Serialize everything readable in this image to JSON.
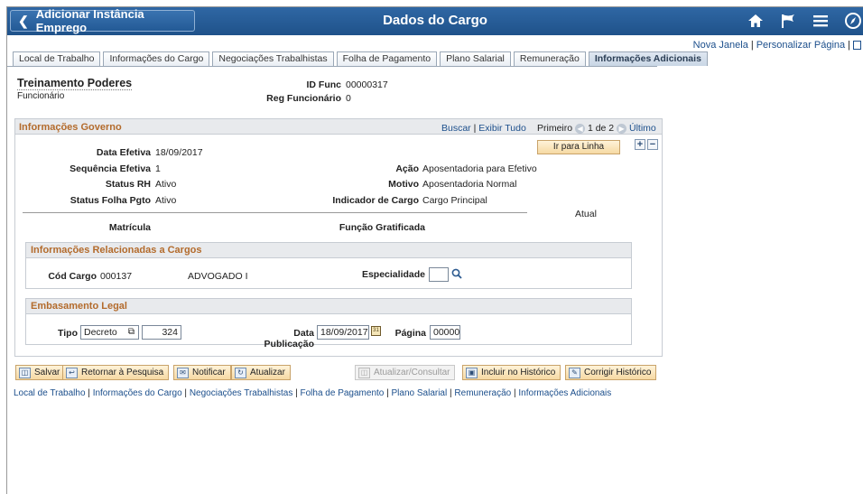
{
  "header": {
    "back_label": "Adicionar Instância Emprego",
    "title": "Dados do Cargo",
    "icons": [
      "home-icon",
      "flag-icon",
      "menu-icon",
      "compass-icon"
    ]
  },
  "top_links": {
    "new_window": "Nova Janela",
    "personalize": "Personalizar Página"
  },
  "tabs": [
    {
      "label": "Local de Trabalho"
    },
    {
      "label": "Informações do Cargo"
    },
    {
      "label": "Negociações Trabalhistas"
    },
    {
      "label": "Folha de Pagamento"
    },
    {
      "label": "Plano Salarial"
    },
    {
      "label": "Remuneração"
    },
    {
      "label": "Informações Adicionais"
    }
  ],
  "employee": {
    "name": "Treinamento Poderes",
    "role": "Funcionário",
    "id_label": "ID Func",
    "id_value": "00000317",
    "reg_label": "Reg Funcionário",
    "reg_value": "0"
  },
  "gov": {
    "title": "Informações Governo",
    "search": "Buscar",
    "view_all": "Exibir Tudo",
    "first": "Primeiro",
    "pagination": "1 de 2",
    "last": "Último",
    "goto_row": "Ir para Linha",
    "data_efetiva_label": "Data Efetiva",
    "data_efetiva": "18/09/2017",
    "seq_label": "Sequência Efetiva",
    "seq": "1",
    "status_rh_label": "Status RH",
    "status_rh": "Ativo",
    "status_folha_label": "Status Folha Pgto",
    "status_folha": "Ativo",
    "acao_label": "Ação",
    "acao": "Aposentadoria para Efetivo",
    "motivo_label": "Motivo",
    "motivo": "Aposentadoria Normal",
    "indicador_label": "Indicador de Cargo",
    "indicador": "Cargo Principal",
    "atual": "Atual",
    "matricula_label": "Matrícula",
    "funcao_label": "Função Gratificada"
  },
  "cargos": {
    "title": "Informações Relacionadas a Cargos",
    "cod_label": "Cód Cargo",
    "cod_value": "000137",
    "cargo_desc": "ADVOGADO I",
    "especialidade_label": "Especialidade",
    "especialidade_value": ""
  },
  "legal": {
    "title": "Embasamento Legal",
    "tipo_label": "Tipo",
    "tipo_value": "Decreto",
    "numero": "324",
    "data_pub_label": "Data Publicação",
    "data_pub": "18/09/2017",
    "pagina_label": "Página",
    "pagina": "00000"
  },
  "actions": {
    "save": "Salvar",
    "return": "Retornar à Pesquisa",
    "notify": "Notificar",
    "refresh": "Atualizar",
    "update_display": "Atualizar/Consultar",
    "include_history": "Incluir no Histórico",
    "correct_history": "Corrigir Histórico"
  },
  "bottom_links": [
    "Local de Trabalho",
    "Informações do Cargo",
    "Negociações Trabalhistas",
    "Folha de Pagamento",
    "Plano Salarial",
    "Remuneração",
    "Informações Adicionais"
  ]
}
